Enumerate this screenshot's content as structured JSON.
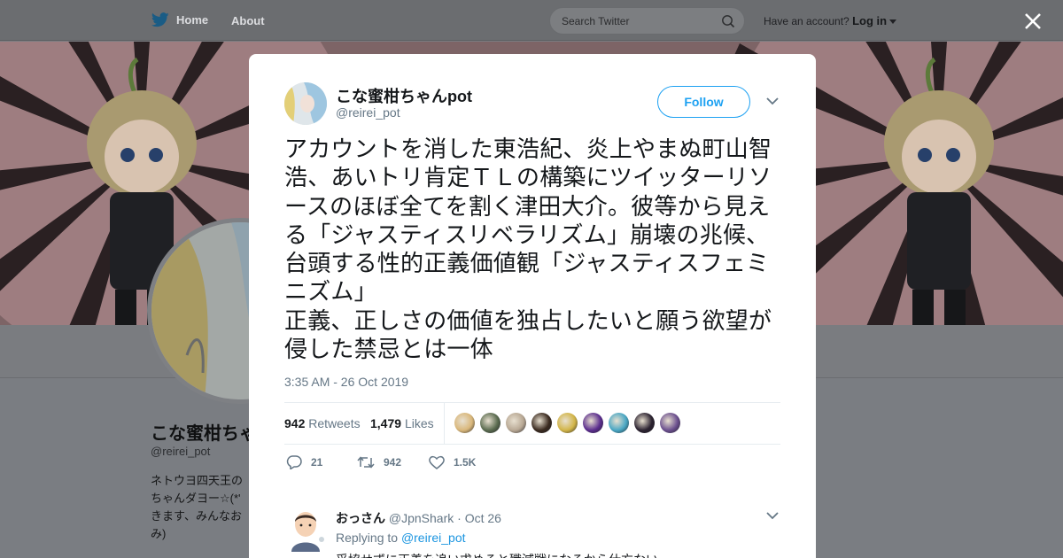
{
  "nav": {
    "home_label": "Home",
    "about_label": "About",
    "search_placeholder": "Search Twitter",
    "account_prompt": "Have an account?",
    "login_label": "Log in"
  },
  "profile": {
    "name": "こな蜜柑ちゃ",
    "handle": "@reirei_pot",
    "bio": "ネトウヨ四天王の ちゃんダヨー☆(*' きます、みんなお み)"
  },
  "tweet": {
    "author_name": "こな蜜柑ちゃんpot",
    "author_handle": "@reirei_pot",
    "follow_label": "Follow",
    "text": "アカウントを消した東浩紀、炎上やまぬ町山智浩、あいトリ肯定ＴＬの構築にツイッターリソースのほぼ全てを割く津田大介。彼等から見える「ジャスティスリベラリズム」崩壊の兆候、台頭する性的正義価値観「ジャスティスフェミニズム」\n正義、正しさの価値を独占したいと願う欲望が侵した禁忌とは一体",
    "timestamp": "3:35 AM - 26 Oct 2019",
    "retweet_count": "942",
    "retweet_label": "Retweets",
    "like_count": "1,479",
    "like_label": "Likes",
    "actions": {
      "reply_count": "21",
      "retweet_count": "942",
      "like_count": "1.5K"
    },
    "liker_colors": [
      "#d9b77a",
      "#5a6b4f",
      "#b8a894",
      "#3a2a1f",
      "#d2b548",
      "#5b2d8e",
      "#49a7c4",
      "#2b2230",
      "#6b4f8e"
    ]
  },
  "reply": {
    "author_name": "おっさん",
    "author_handle": "@JpnShark",
    "date": "Oct 26",
    "replying_to_prefix": "Replying to",
    "replying_to_handle": "@reirei_pot",
    "text": "妥協せずに正義を追い求めると殲滅戦になるから仕方ない"
  }
}
